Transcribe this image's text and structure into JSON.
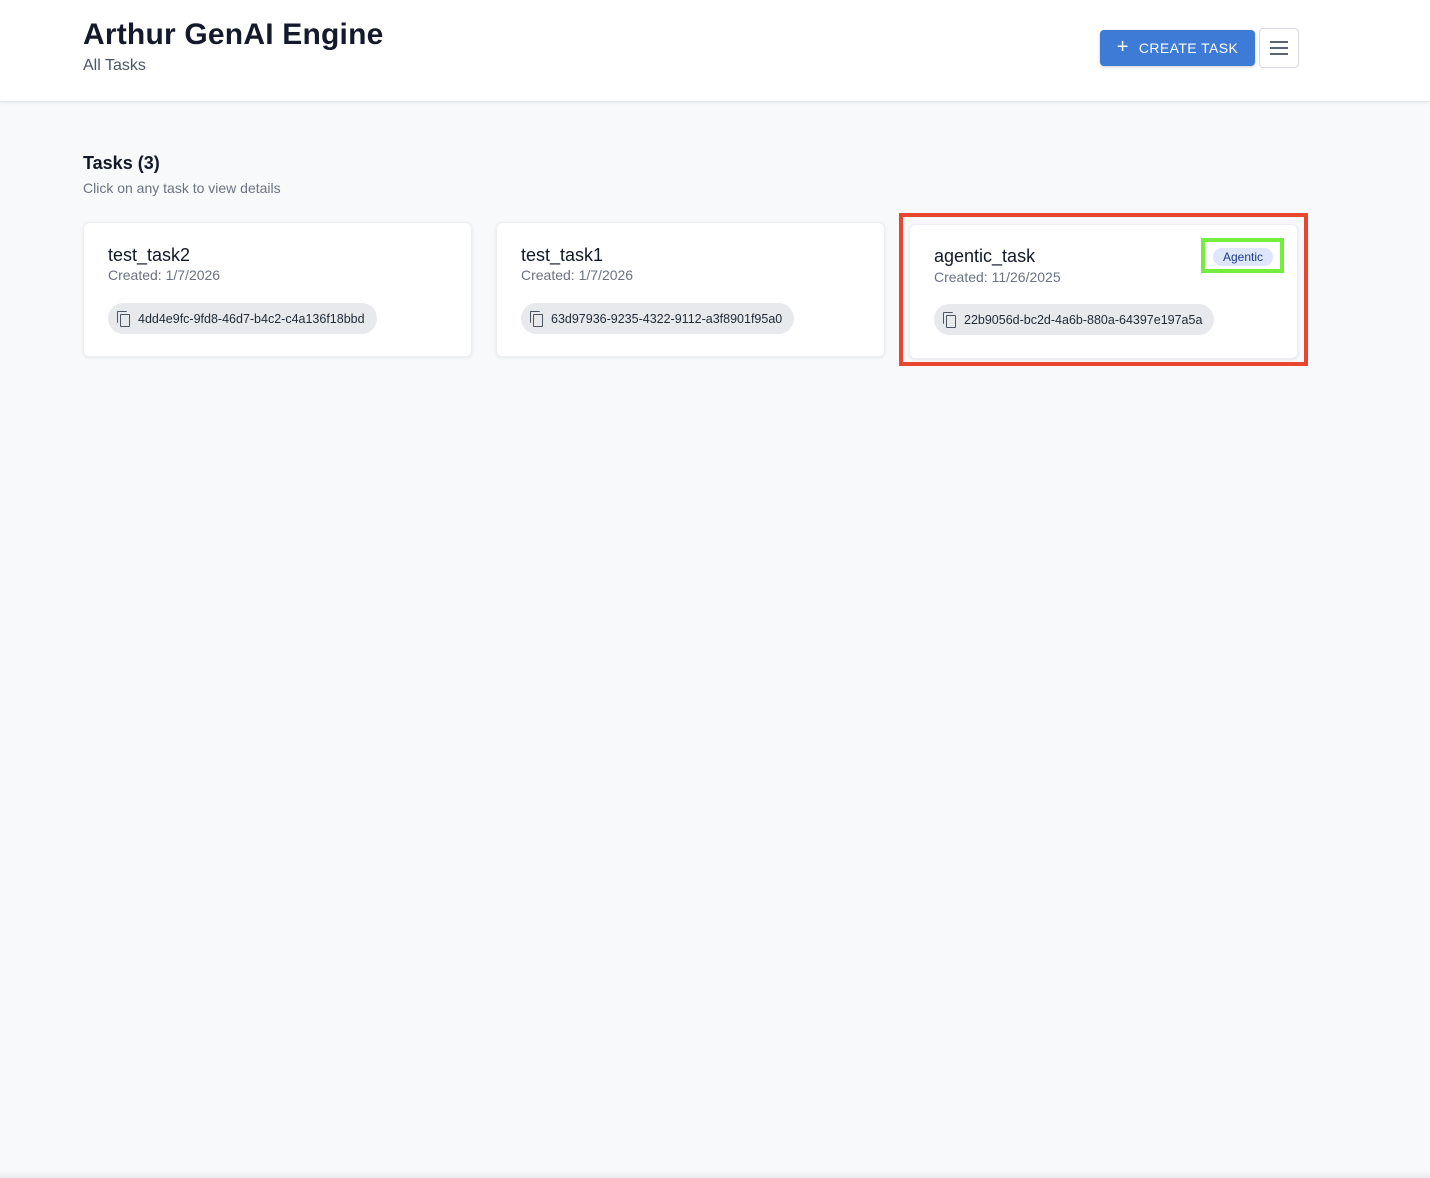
{
  "header": {
    "title": "Arthur GenAI Engine",
    "subtitle": "All Tasks",
    "create_button_label": "CREATE TASK",
    "create_button_icon": "plus-icon",
    "menu_icon": "hamburger-menu-icon",
    "accent_color": "#3d7bd6"
  },
  "tasks_section": {
    "title": "Tasks (3)",
    "subtitle": "Click on any task to view details"
  },
  "tasks": [
    {
      "name": "test_task2",
      "created": "Created: 1/7/2026",
      "id": "4dd4e9fc-9fd8-46d7-b4c2-c4a136f18bbd"
    },
    {
      "name": "test_task1",
      "created": "Created: 1/7/2026",
      "id": "63d97936-9235-4322-9112-a3f8901f95a0"
    },
    {
      "name": "agentic_task",
      "created": "Created: 11/26/2025",
      "id": "22b9056d-bc2d-4a6b-880a-64397e197a5a",
      "badge": "Agentic"
    }
  ],
  "annotations": {
    "red_box_color": "#e8462e",
    "green_box_color": "#74ee3c"
  }
}
